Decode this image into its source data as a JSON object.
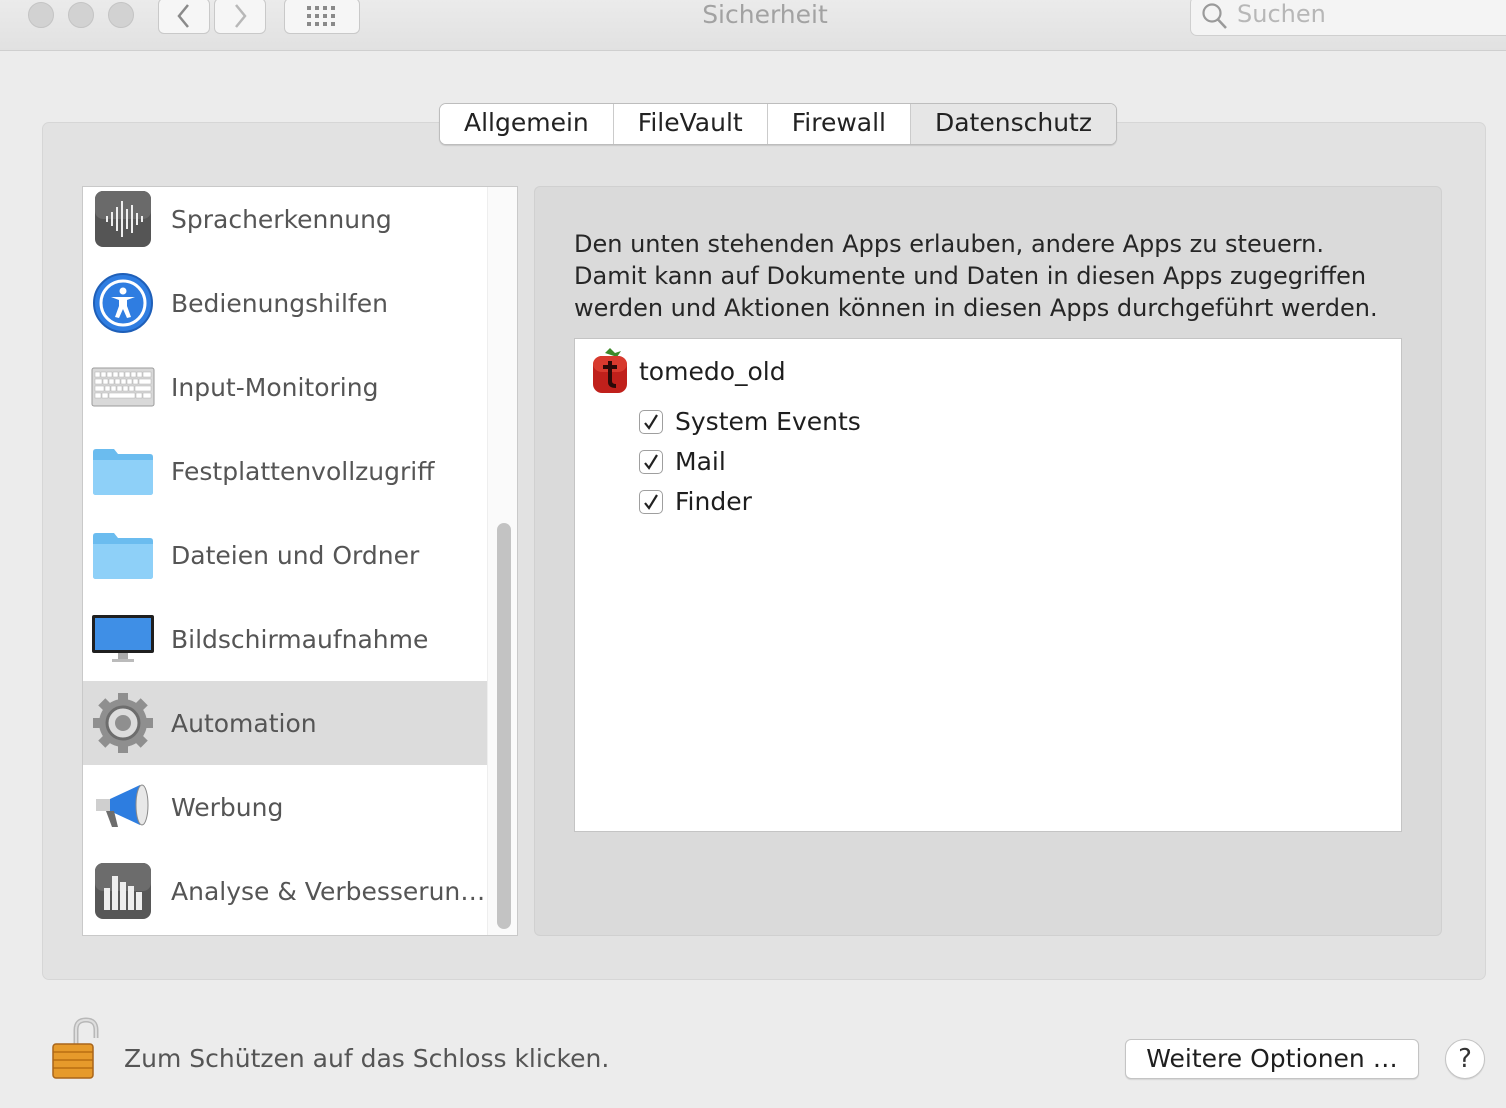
{
  "window": {
    "title": "Sicherheit",
    "search_placeholder": "Suchen"
  },
  "tabs": [
    {
      "label": "Allgemein",
      "selected": false
    },
    {
      "label": "FileVault",
      "selected": false
    },
    {
      "label": "Firewall",
      "selected": false
    },
    {
      "label": "Datenschutz",
      "selected": true
    }
  ],
  "categories": [
    {
      "label": "Spracherkennung",
      "icon": "speech-recognition-icon"
    },
    {
      "label": "Bedienungshilfen",
      "icon": "accessibility-icon"
    },
    {
      "label": "Input-Monitoring",
      "icon": "keyboard-icon"
    },
    {
      "label": "Festplattenvollzugriff",
      "icon": "folder-icon"
    },
    {
      "label": "Dateien und Ordner",
      "icon": "folder-icon"
    },
    {
      "label": "Bildschirmaufnahme",
      "icon": "display-icon"
    },
    {
      "label": "Automation",
      "icon": "gear-icon",
      "selected": true
    },
    {
      "label": "Werbung",
      "icon": "megaphone-icon"
    },
    {
      "label": "Analyse & Verbesserun…",
      "icon": "bar-chart-icon"
    }
  ],
  "detail": {
    "description": [
      "Den unten stehenden Apps erlauben, andere Apps zu steuern.",
      "Damit kann auf Dokumente und Daten in diesen Apps zugegriffen",
      "werden und Aktionen können in diesen Apps durchgeführt werden."
    ],
    "app": {
      "name": "tomedo_old",
      "icon": "tomedo-app-icon",
      "permissions": [
        {
          "label": "System Events",
          "checked": true
        },
        {
          "label": "Mail",
          "checked": true
        },
        {
          "label": "Finder",
          "checked": true
        }
      ]
    }
  },
  "footer": {
    "lock_text": "Zum Schützen auf das Schloss klicken.",
    "more_options_label": "Weitere Optionen …",
    "help_label": "?"
  },
  "colors": {
    "window_bg": "#ececec",
    "selected_row": "#dcdcdc",
    "accent_blue": "#2f7de1"
  }
}
